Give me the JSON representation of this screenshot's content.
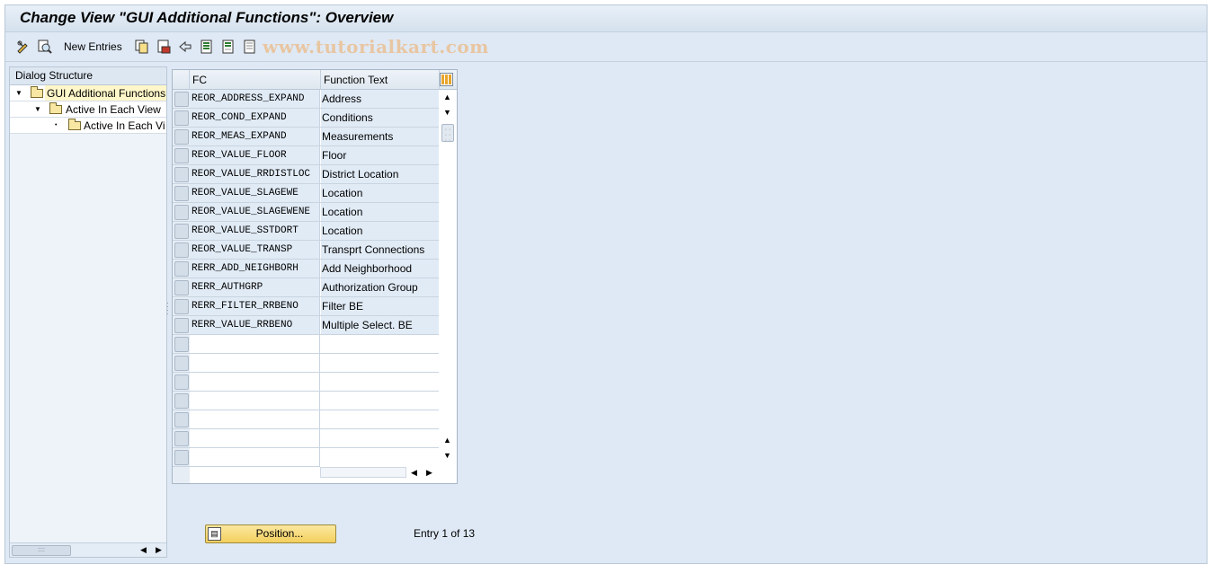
{
  "window": {
    "title": "Change View \"GUI Additional Functions\": Overview"
  },
  "toolbar": {
    "icons": [
      "display-change-icon",
      "details-icon",
      "copy-as-icon",
      "delete-icon",
      "undo-change-icon",
      "select-all-icon",
      "select-block-icon",
      "deselect-all-icon"
    ],
    "new_entries_label": "New Entries",
    "watermark": "www.tutorialkart.com"
  },
  "dialog_structure": {
    "header": "Dialog Structure",
    "items": [
      {
        "label": "GUI Additional Functions",
        "selected": true
      },
      {
        "label": "Active In Each View"
      },
      {
        "label": "Active In Each Vi"
      }
    ]
  },
  "table": {
    "columns": [
      "FC",
      "Function Text"
    ],
    "rows": [
      {
        "fc": "REOR_ADDRESS_EXPAND",
        "text": "Address"
      },
      {
        "fc": "REOR_COND_EXPAND",
        "text": "Conditions"
      },
      {
        "fc": "REOR_MEAS_EXPAND",
        "text": "Measurements"
      },
      {
        "fc": "REOR_VALUE_FLOOR",
        "text": "Floor"
      },
      {
        "fc": "REOR_VALUE_RRDISTLOC",
        "text": "District Location"
      },
      {
        "fc": "REOR_VALUE_SLAGEWE",
        "text": "Location"
      },
      {
        "fc": "REOR_VALUE_SLAGEWENE",
        "text": "Location"
      },
      {
        "fc": "REOR_VALUE_SSTDORT",
        "text": "Location"
      },
      {
        "fc": "REOR_VALUE_TRANSP",
        "text": "Transprt Connections"
      },
      {
        "fc": "RERR_ADD_NEIGHBORH",
        "text": "Add Neighborhood"
      },
      {
        "fc": "RERR_AUTHGRP",
        "text": "Authorization Group"
      },
      {
        "fc": "RERR_FILTER_RRBENO",
        "text": "Filter BE"
      },
      {
        "fc": "RERR_VALUE_RRBENO",
        "text": "Multiple Select. BE"
      }
    ]
  },
  "footer": {
    "position_button": "Position...",
    "entry_info": "Entry 1 of 13"
  }
}
